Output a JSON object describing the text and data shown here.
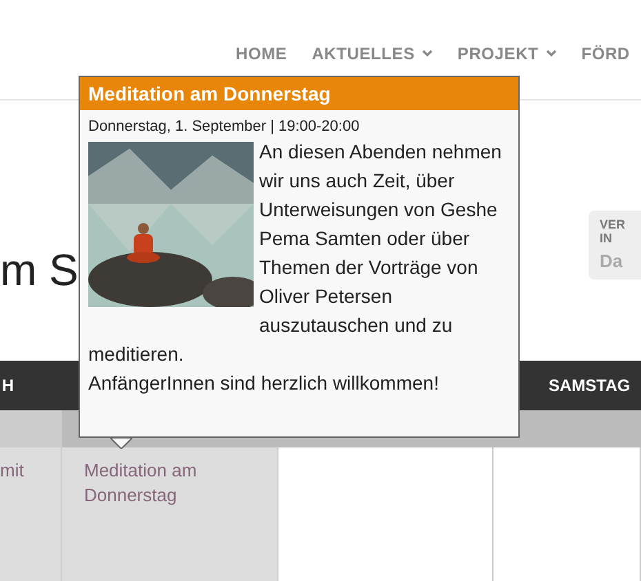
{
  "nav": [
    {
      "label": "HOME",
      "has_submenu": false
    },
    {
      "label": "AKTUELLES",
      "has_submenu": true
    },
    {
      "label": "PROJEKT",
      "has_submenu": true
    },
    {
      "label": "FÖRD",
      "has_submenu": false
    }
  ],
  "page_title": "m S",
  "side_widget": {
    "heading": "VER IN",
    "value": "Da"
  },
  "calendar": {
    "columns": [
      {
        "header": "H",
        "shaded": true,
        "event": "mit"
      },
      {
        "shaded": true,
        "event": "Meditation am Donnerstag"
      },
      {
        "shaded": false
      },
      {
        "header": "SAMSTAG",
        "shaded": false
      }
    ]
  },
  "popup": {
    "title": "Meditation am Donnerstag",
    "date": "Donnerstag, 1. September | 19:00-20:00",
    "description_beside_picture": "An diesen Abenden nehmen wir uns auch Zeit, über Unterweisungen von Geshe Pema Samten oder über Themen der Vorträge von Oliver Petersen auszutauschen und zu",
    "description_below": "meditieren.",
    "note": "AnfängerInnen sind herzlich willkommen!"
  }
}
